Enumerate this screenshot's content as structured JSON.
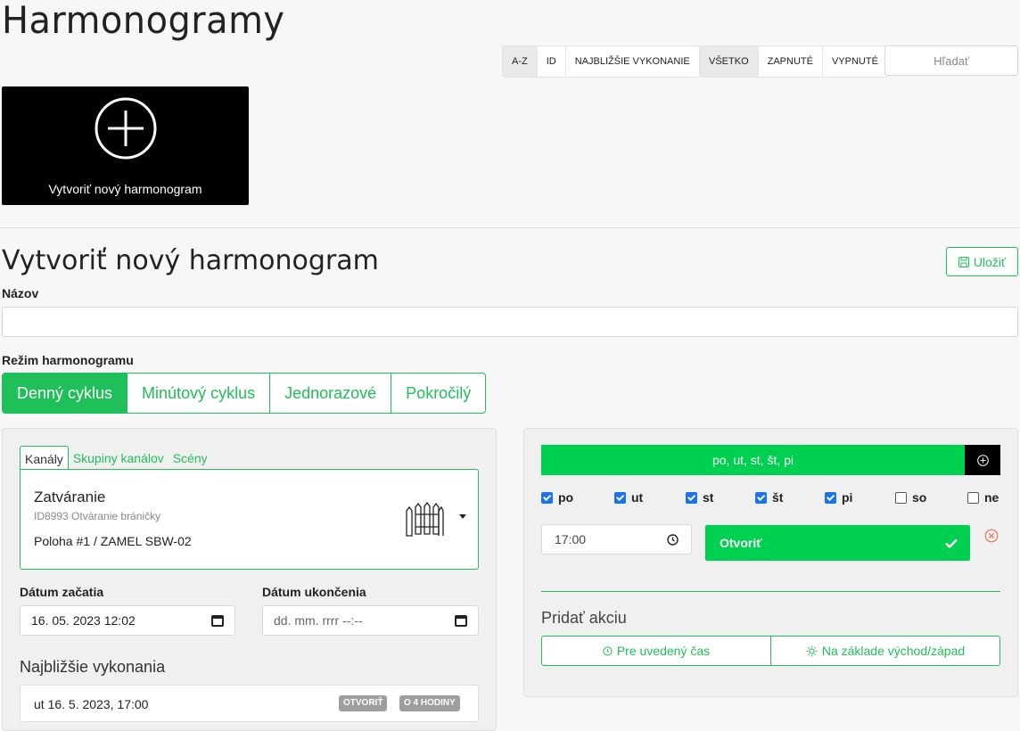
{
  "page": {
    "title": "Harmonogramy"
  },
  "sort": {
    "options": [
      "A-Z",
      "ID",
      "NAJBLIŽŠIE VYKONANIE"
    ],
    "selected": "A-Z"
  },
  "filter": {
    "options": [
      "VŠETKO",
      "ZAPNUTÉ",
      "VYPNUTÉ"
    ],
    "selected": "VŠETKO"
  },
  "search": {
    "placeholder": "Hľadať"
  },
  "create_tile": {
    "label": "Vytvoriť nový harmonogram",
    "icon": "plus-circle-icon"
  },
  "form": {
    "title": "Vytvoriť nový harmonogram",
    "save_label": "Uložiť",
    "name_label": "Názov",
    "name_value": "",
    "mode_label": "Režim harmonogramu",
    "modes": [
      "Denný cyklus",
      "Minútový cyklus",
      "Jednorazové",
      "Pokročilý"
    ],
    "mode_selected": "Denný cyklus"
  },
  "target": {
    "tabs": [
      "Kanály",
      "Skupiny kanálov",
      "Scény"
    ],
    "tab_selected": "Kanály",
    "channel": {
      "name": "Zatváranie",
      "id_desc": "ID8993 Otváranie bráničky",
      "location": "Poloha #1 / ZAMEL SBW-02",
      "icon": "gate-icon"
    }
  },
  "dates": {
    "start_label": "Dátum začatia",
    "start_value": "16. 05. 2023 12:02",
    "end_label": "Dátum ukončenia",
    "end_placeholder": "dd. mm. rrrr --:--"
  },
  "executions": {
    "label": "Najbližšie vykonania",
    "items": [
      {
        "text": "ut 16. 5. 2023, 17:00",
        "action_badge": "OTVORIŤ",
        "when_badge": "O 4 HODINY"
      }
    ]
  },
  "schedule": {
    "days_summary": "po, ut, st, št, pi",
    "days": [
      {
        "label": "po",
        "checked": true
      },
      {
        "label": "ut",
        "checked": true
      },
      {
        "label": "st",
        "checked": true
      },
      {
        "label": "št",
        "checked": true
      },
      {
        "label": "pi",
        "checked": true
      },
      {
        "label": "so",
        "checked": false
      },
      {
        "label": "ne",
        "checked": false
      }
    ],
    "time": "17:00",
    "action": "Otvoriť",
    "add_action_label": "Pridať akciu",
    "add_options": [
      "Pre uvedený čas",
      "Na základe východ/západ"
    ]
  },
  "colors": {
    "accent": "#1fbf5a",
    "accent_bright": "#00d050",
    "badge": "#9e9e9e"
  }
}
